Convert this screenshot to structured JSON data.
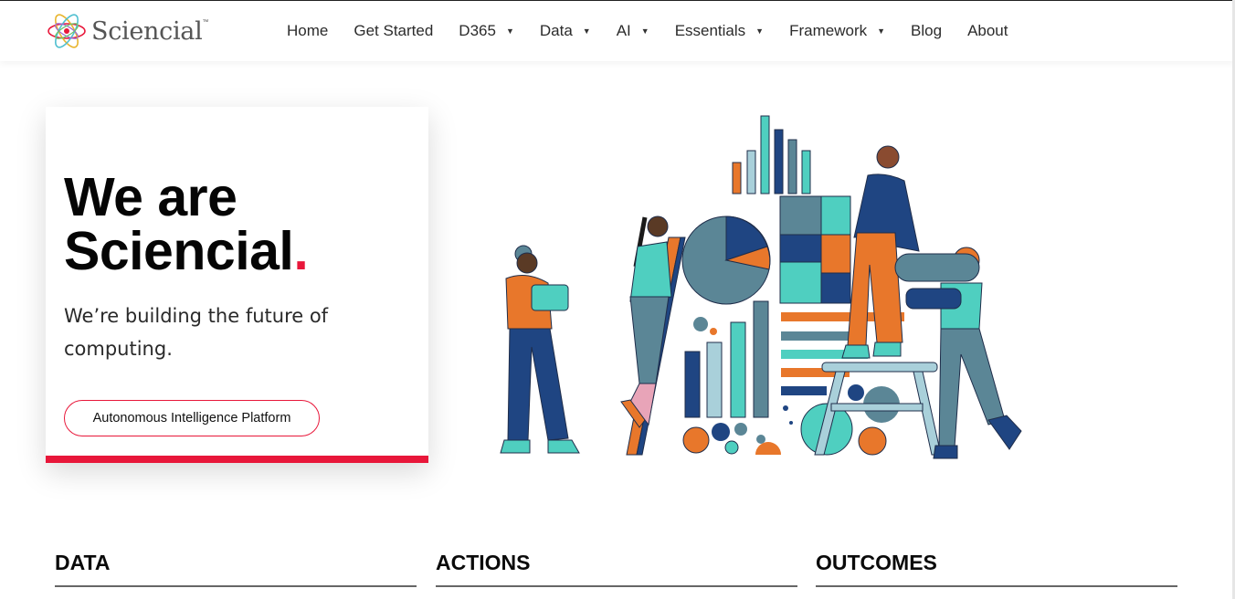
{
  "brand": {
    "name": "Sciencial",
    "tm": "™"
  },
  "nav": {
    "items": [
      {
        "label": "Home",
        "dropdown": false
      },
      {
        "label": "Get Started",
        "dropdown": false
      },
      {
        "label": "D365",
        "dropdown": true
      },
      {
        "label": "Data",
        "dropdown": true
      },
      {
        "label": "AI",
        "dropdown": true
      },
      {
        "label": "Essentials",
        "dropdown": true
      },
      {
        "label": "Framework",
        "dropdown": true
      },
      {
        "label": "Blog",
        "dropdown": false
      },
      {
        "label": "About",
        "dropdown": false
      }
    ],
    "caret": "▼"
  },
  "hero": {
    "title_line1": "We are",
    "title_line2": "Sciencial",
    "title_dot": ".",
    "subtitle": "We’re building the future of computing.",
    "cta_label": "Autonomous Intelligence Platform"
  },
  "sections": {
    "data": "DATA",
    "actions": "ACTIONS",
    "outcomes": "OUTCOMES"
  },
  "colors": {
    "accent_red": "#e8173a",
    "navy": "#1f4582",
    "teal": "#4fcfc0",
    "orange": "#e8772b",
    "slate": "#5b8696",
    "light_blue": "#a9d0da"
  }
}
